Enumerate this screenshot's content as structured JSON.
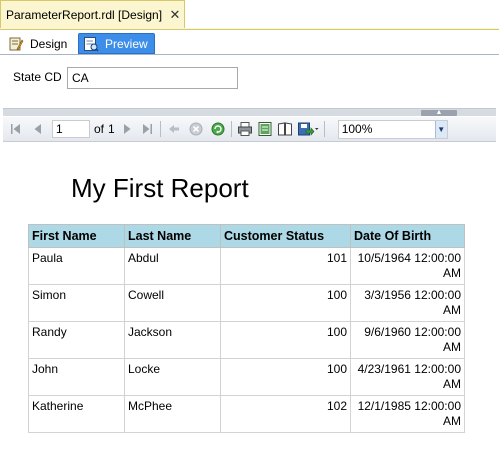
{
  "document_tab": {
    "title": "ParameterReport.rdl [Design]",
    "close": "✕"
  },
  "view_tabs": {
    "design": "Design",
    "preview": "Preview"
  },
  "parameters": {
    "state_label": "State CD",
    "state_value": "CA"
  },
  "toolbar": {
    "page_current": "1",
    "page_of": "of",
    "page_total": "1",
    "zoom": "100%"
  },
  "report": {
    "title": "My First Report",
    "columns": [
      "First Name",
      "Last Name",
      "Customer Status",
      "Date Of Birth"
    ],
    "rows": [
      {
        "first": "Paula",
        "last": "Abdul",
        "status": "101",
        "dob": "10/5/1964 12:00:00 AM"
      },
      {
        "first": "Simon",
        "last": "Cowell",
        "status": "100",
        "dob": "3/3/1956 12:00:00 AM"
      },
      {
        "first": "Randy",
        "last": "Jackson",
        "status": "100",
        "dob": "9/6/1960 12:00:00 AM"
      },
      {
        "first": "John",
        "last": "Locke",
        "status": "100",
        "dob": "4/23/1961 12:00:00 AM"
      },
      {
        "first": "Katherine",
        "last": "McPhee",
        "status": "102",
        "dob": "12/1/1985 12:00:00 AM"
      }
    ]
  }
}
